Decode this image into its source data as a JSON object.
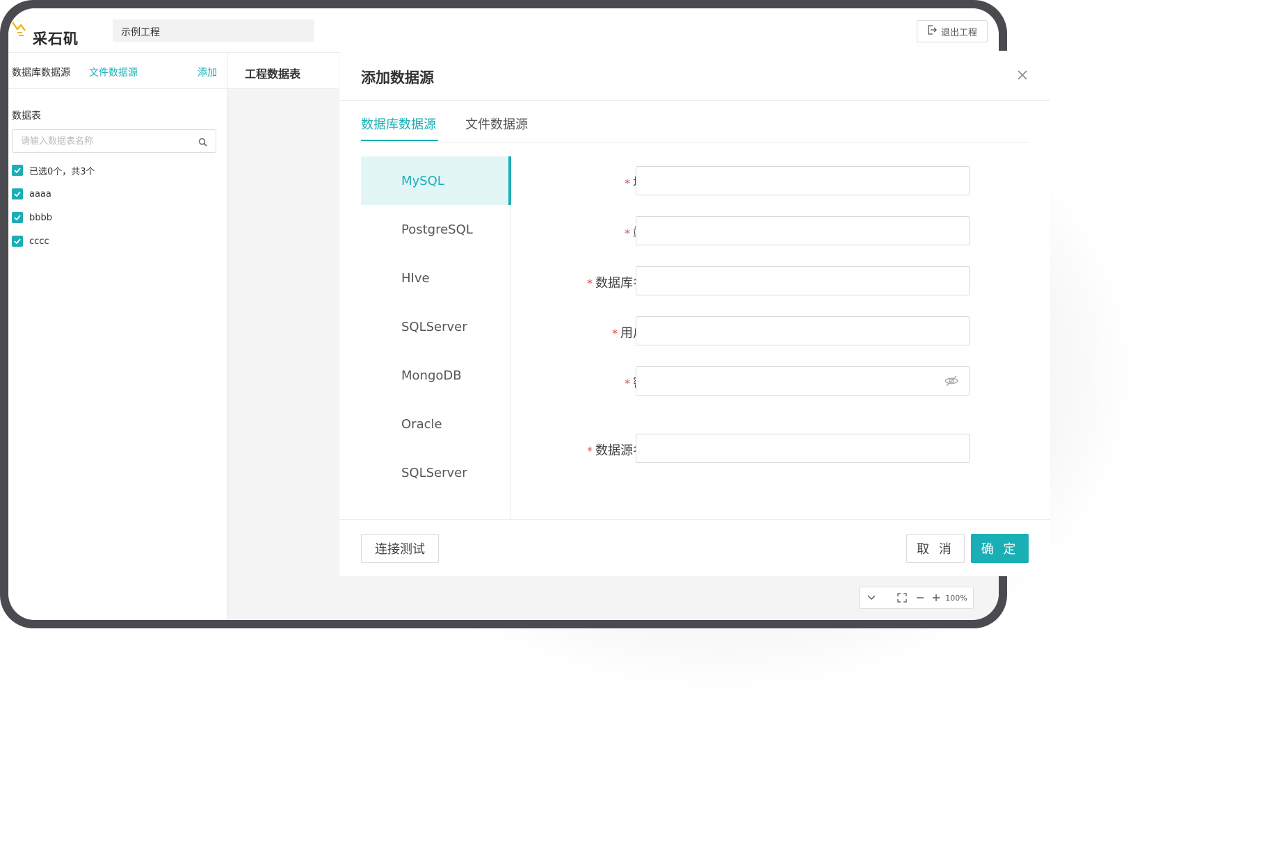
{
  "header": {
    "app_title": "采石矶",
    "project_name": "示例工程",
    "exit_label": "退出工程"
  },
  "left_panel": {
    "tabs": [
      {
        "label": "数据库数据源"
      },
      {
        "label": "文件数据源"
      }
    ],
    "add_label": "添加",
    "section_title": "数据表",
    "search_placeholder": "请输入数据表名称",
    "select_summary": "已选0个，共3个",
    "tables": [
      {
        "name": "aaaa",
        "checked": true
      },
      {
        "name": "bbbb",
        "checked": true
      },
      {
        "name": "cccc",
        "checked": true
      }
    ]
  },
  "main": {
    "title": "工程数据表",
    "zoom_level": "100%"
  },
  "modal": {
    "title": "添加数据源",
    "tabs": [
      {
        "label": "数据库数据源",
        "active": true
      },
      {
        "label": "文件数据源",
        "active": false
      }
    ],
    "db_types": [
      {
        "label": "MySQL",
        "active": true
      },
      {
        "label": "PostgreSQL"
      },
      {
        "label": "HIve"
      },
      {
        "label": "SQLServer"
      },
      {
        "label": "MongoDB"
      },
      {
        "label": "Oracle"
      },
      {
        "label": "SQLServer"
      }
    ],
    "fields": [
      {
        "label": "地址",
        "required": "*",
        "value": ""
      },
      {
        "label": "端口",
        "required": "*",
        "value": ""
      },
      {
        "label": "数据库名称",
        "required": "*",
        "value": ""
      },
      {
        "label": "用户名",
        "required": "*",
        "value": ""
      },
      {
        "label": "密码",
        "required": "*",
        "value": ""
      },
      {
        "label": "数据源名称",
        "required": "*",
        "value": ""
      }
    ],
    "test_button": "连接测试",
    "cancel_button": "取 消",
    "ok_button": "确 定"
  },
  "colors": {
    "accent": "#1aaeb5",
    "required": "#e34a4a",
    "device_frame": "#4a4b50"
  }
}
